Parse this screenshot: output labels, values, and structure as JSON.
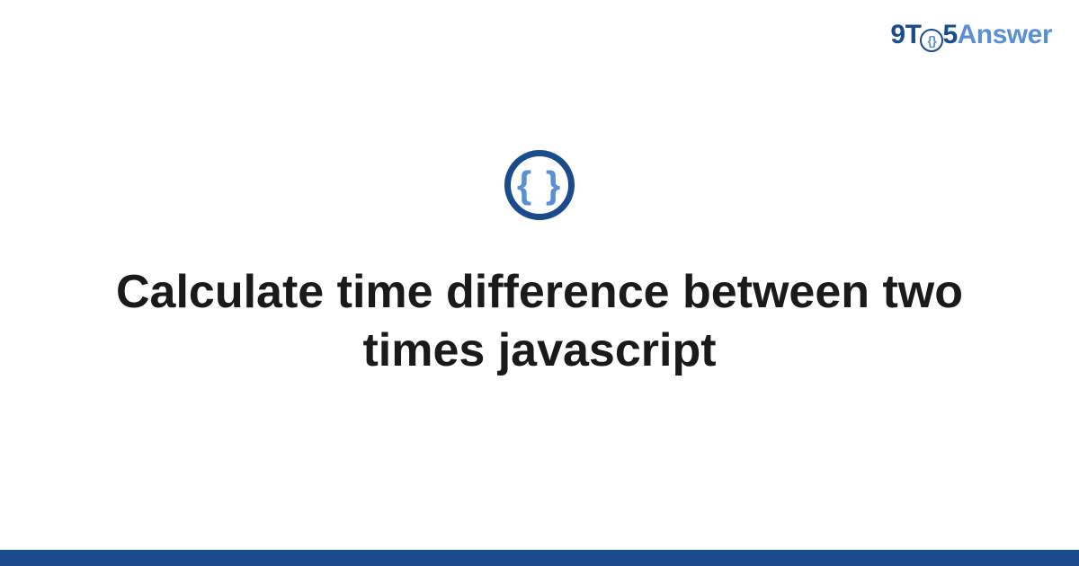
{
  "brand": {
    "part1a": "9T",
    "emblem": "{}",
    "part1b": "5",
    "part2": "Answer"
  },
  "icon": {
    "braces": "{ }"
  },
  "title": "Calculate time difference between two times javascript"
}
